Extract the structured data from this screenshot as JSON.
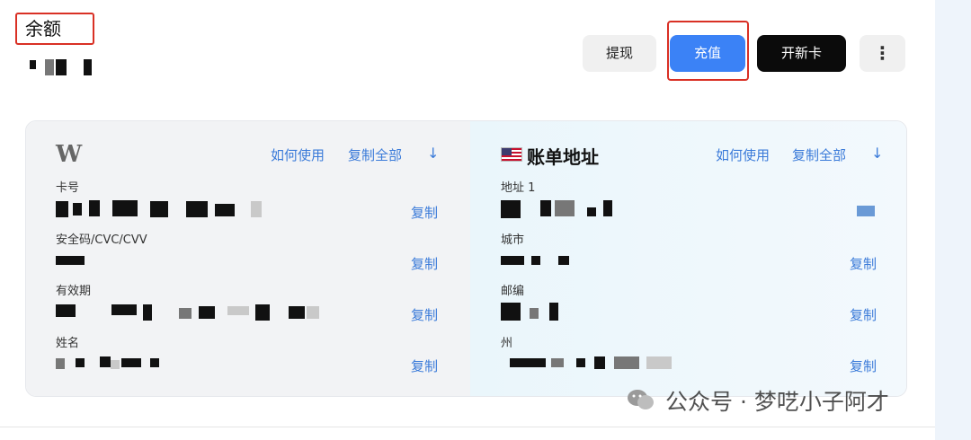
{
  "balance": {
    "label": "余额"
  },
  "toolbar": {
    "withdraw_label": "提现",
    "topup_label": "充值",
    "new_card_label": "开新卡",
    "more_label": "⋮"
  },
  "card_panel": {
    "brand_letter": "W",
    "how_to_use": "如何使用",
    "copy_all": "复制全部",
    "download_icon": "↓",
    "fields": [
      {
        "label": "卡号",
        "copy": "复制"
      },
      {
        "label": "安全码/CVC/CVV",
        "copy": "复制"
      },
      {
        "label": "有效期",
        "copy": "复制"
      },
      {
        "label": "姓名",
        "copy": "复制"
      }
    ]
  },
  "billing_panel": {
    "title": "账单地址",
    "how_to_use": "如何使用",
    "copy_all": "复制全部",
    "download_icon": "↓",
    "fields": [
      {
        "label": "地址 1",
        "copy": ""
      },
      {
        "label": "城市",
        "copy": "复制"
      },
      {
        "label": "邮编",
        "copy": "复制"
      },
      {
        "label": "州",
        "copy": "复制"
      }
    ]
  },
  "watermark": {
    "text": "公众号 · 梦呓小子阿才"
  },
  "colors": {
    "accent": "#3b82f6",
    "link": "#3b7bd9",
    "highlight_border": "#d93025",
    "dark_button": "#0b0b0b"
  }
}
